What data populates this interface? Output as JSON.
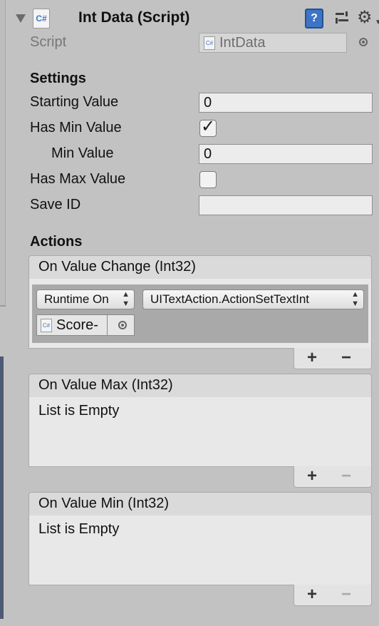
{
  "header": {
    "title": "Int Data (Script)",
    "script_icon": "C#",
    "icons": [
      "help-icon",
      "preset-icon",
      "gear-icon"
    ]
  },
  "script_row": {
    "label": "Script",
    "value": "IntData"
  },
  "settings": {
    "heading": "Settings",
    "starting_value": {
      "label": "Starting Value",
      "value": "0"
    },
    "has_min_value": {
      "label": "Has Min Value",
      "checked": true
    },
    "min_value": {
      "label": "Min Value",
      "value": "0"
    },
    "has_max_value": {
      "label": "Has Max Value",
      "checked": false
    },
    "save_id": {
      "label": "Save ID",
      "value": ""
    }
  },
  "actions": {
    "heading": "Actions",
    "on_value_change": {
      "title": "On Value Change (Int32)",
      "runtime_mode": "Runtime On",
      "function": "UITextAction.ActionSetTextInt",
      "target_object": "Score-"
    },
    "on_value_max": {
      "title": "On Value Max (Int32)",
      "empty_text": "List is Empty"
    },
    "on_value_min": {
      "title": "On Value Min (Int32)",
      "empty_text": "List is Empty"
    },
    "add_label": "+",
    "remove_label": "−"
  }
}
